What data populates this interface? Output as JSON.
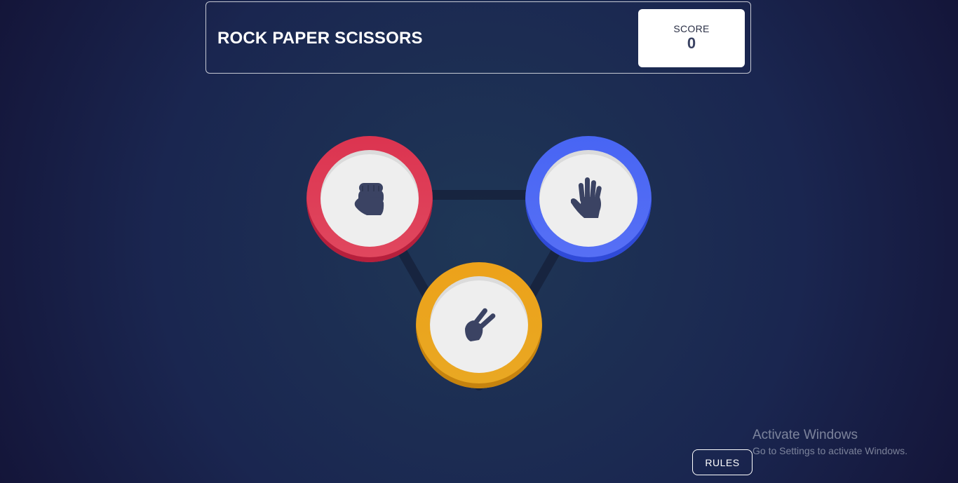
{
  "header": {
    "title": "ROCK PAPER SCISSORS",
    "score_label": "SCORE",
    "score_value": "0"
  },
  "tokens": [
    {
      "name": "rock",
      "icon": "fist-icon",
      "color": "#dc3450"
    },
    {
      "name": "paper",
      "icon": "open-hand-icon",
      "color": "#4865f4"
    },
    {
      "name": "scissors",
      "icon": "scissors-hand-icon",
      "color": "#eca21a"
    }
  ],
  "rules_button": {
    "label": "RULES"
  },
  "watermark": {
    "title": "Activate Windows",
    "subtitle": "Go to Settings to activate Windows."
  }
}
